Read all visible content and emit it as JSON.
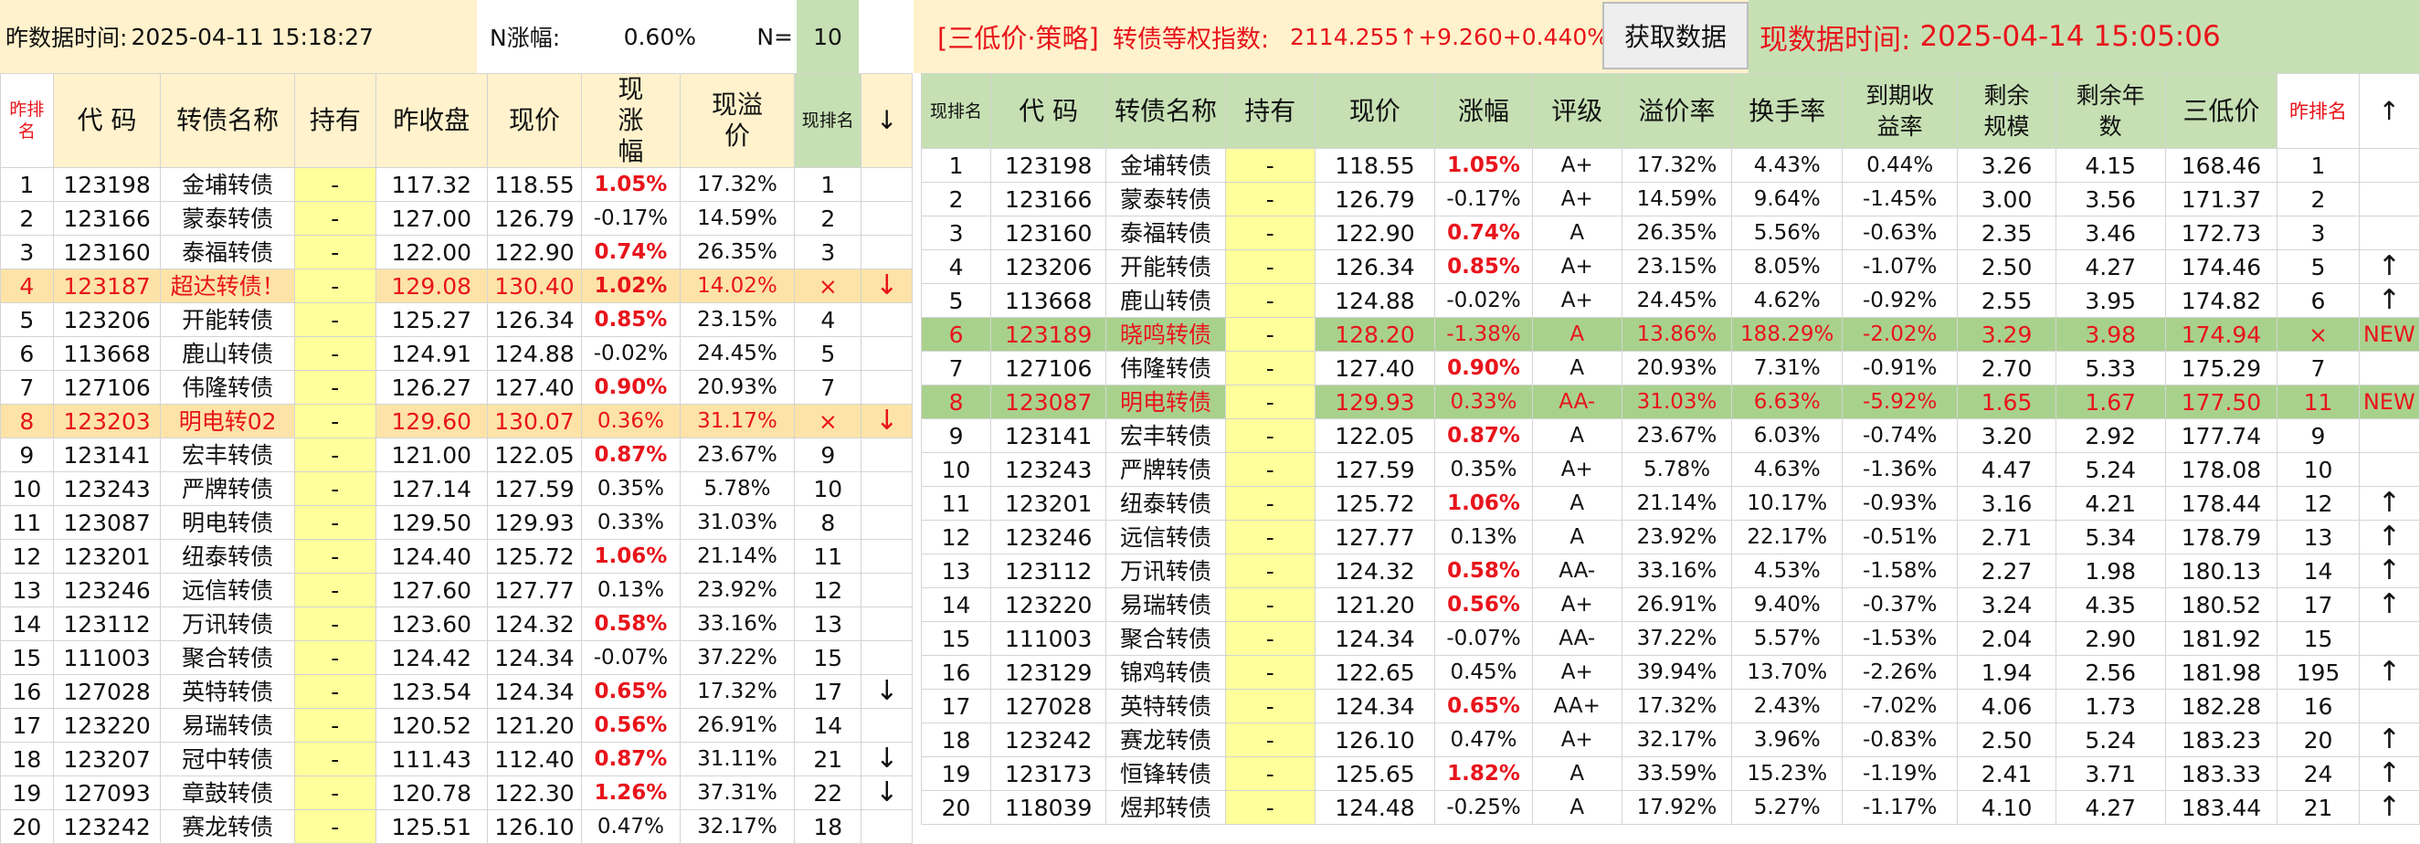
{
  "header": {
    "prev_time_label": "昨数据时间:",
    "prev_time": "2025-04-11 15:18:27",
    "n_change_label": "N涨幅:",
    "n_change_value": "0.60%",
    "n_label": "N=",
    "n_value": "10",
    "strategy": "[三低价·策略]",
    "index_label": "转债等权指数:",
    "index_value": "2114.255↑+9.260+0.440%",
    "fetch_button": "获取数据",
    "now_time_label": "现数据时间:",
    "now_time": "2025-04-14 15:05:06",
    "colors": {
      "title_yellow": "#fff2cc",
      "n_green": "#c6e0b4",
      "strategy_yellow": "#fff2cc",
      "now_green": "#c6e0b4",
      "red": "#e8141b"
    }
  },
  "left_table": {
    "headers": [
      "昨排名",
      "代 码",
      "转债名称",
      "持有",
      "昨收盘",
      "现价",
      "现涨幅",
      "现溢价",
      "现排名",
      "↓"
    ],
    "rows": [
      [
        "1",
        "123198",
        "金埔转债",
        "-",
        "117.32",
        "118.55",
        "1.05%",
        "17.32%",
        "1",
        ""
      ],
      [
        "2",
        "123166",
        "蒙泰转债",
        "-",
        "127.00",
        "126.79",
        "-0.17%",
        "14.59%",
        "2",
        ""
      ],
      [
        "3",
        "123160",
        "泰福转债",
        "-",
        "122.00",
        "122.90",
        "0.74%",
        "26.35%",
        "3",
        ""
      ],
      [
        "4",
        "123187",
        "超达转债！",
        "-",
        "129.08",
        "130.40",
        "1.02%",
        "14.02%",
        "×",
        "↓"
      ],
      [
        "5",
        "123206",
        "开能转债",
        "-",
        "125.27",
        "126.34",
        "0.85%",
        "23.15%",
        "4",
        ""
      ],
      [
        "6",
        "113668",
        "鹿山转债",
        "-",
        "124.91",
        "124.88",
        "-0.02%",
        "24.45%",
        "5",
        ""
      ],
      [
        "7",
        "127106",
        "伟隆转债",
        "-",
        "126.27",
        "127.40",
        "0.90%",
        "20.93%",
        "7",
        ""
      ],
      [
        "8",
        "123203",
        "明电转02",
        "-",
        "129.60",
        "130.07",
        "0.36%",
        "31.17%",
        "×",
        "↓"
      ],
      [
        "9",
        "123141",
        "宏丰转债",
        "-",
        "121.00",
        "122.05",
        "0.87%",
        "23.67%",
        "9",
        ""
      ],
      [
        "10",
        "123243",
        "严牌转债",
        "-",
        "127.14",
        "127.59",
        "0.35%",
        "5.78%",
        "10",
        ""
      ],
      [
        "11",
        "123087",
        "明电转债",
        "-",
        "129.50",
        "129.93",
        "0.33%",
        "31.03%",
        "8",
        ""
      ],
      [
        "12",
        "123201",
        "纽泰转债",
        "-",
        "124.40",
        "125.72",
        "1.06%",
        "21.14%",
        "11",
        ""
      ],
      [
        "13",
        "123246",
        "远信转债",
        "-",
        "127.60",
        "127.77",
        "0.13%",
        "23.92%",
        "12",
        ""
      ],
      [
        "14",
        "123112",
        "万讯转债",
        "-",
        "123.60",
        "124.32",
        "0.58%",
        "33.16%",
        "13",
        ""
      ],
      [
        "15",
        "111003",
        "聚合转债",
        "-",
        "124.42",
        "124.34",
        "-0.07%",
        "37.22%",
        "15",
        ""
      ],
      [
        "16",
        "127028",
        "英特转债",
        "-",
        "123.54",
        "124.34",
        "0.65%",
        "17.32%",
        "17",
        "↓"
      ],
      [
        "17",
        "123220",
        "易瑞转债",
        "-",
        "120.52",
        "121.20",
        "0.56%",
        "26.91%",
        "14",
        ""
      ],
      [
        "18",
        "123207",
        "冠中转债",
        "-",
        "111.43",
        "112.40",
        "0.87%",
        "31.11%",
        "21",
        "↓"
      ],
      [
        "19",
        "127093",
        "章鼓转债",
        "-",
        "120.78",
        "122.30",
        "1.26%",
        "37.31%",
        "22",
        "↓"
      ],
      [
        "20",
        "123242",
        "赛龙转债",
        "-",
        "125.51",
        "126.10",
        "0.47%",
        "32.17%",
        "18",
        ""
      ]
    ]
  },
  "right_table": {
    "headers": [
      "现排名",
      "代 码",
      "转债名称",
      "持有",
      "现价",
      "涨幅",
      "评级",
      "溢价率",
      "换手率",
      "到期收益率",
      "剩余规模",
      "剩余年数",
      "三低价",
      "昨排名",
      "↑"
    ],
    "rows": [
      [
        "1",
        "123198",
        "金埔转债",
        "-",
        "118.55",
        "1.05%",
        "A+",
        "17.32%",
        "4.43%",
        "0.44%",
        "3.26",
        "4.15",
        "168.46",
        "1",
        ""
      ],
      [
        "2",
        "123166",
        "蒙泰转债",
        "-",
        "126.79",
        "-0.17%",
        "A+",
        "14.59%",
        "9.64%",
        "-1.45%",
        "3.00",
        "3.56",
        "171.37",
        "2",
        ""
      ],
      [
        "3",
        "123160",
        "泰福转债",
        "-",
        "122.90",
        "0.74%",
        "A",
        "26.35%",
        "5.56%",
        "-0.63%",
        "2.35",
        "3.46",
        "172.73",
        "3",
        ""
      ],
      [
        "4",
        "123206",
        "开能转债",
        "-",
        "126.34",
        "0.85%",
        "A+",
        "23.15%",
        "8.05%",
        "-1.07%",
        "2.50",
        "4.27",
        "174.46",
        "5",
        "↑"
      ],
      [
        "5",
        "113668",
        "鹿山转债",
        "-",
        "124.88",
        "-0.02%",
        "A+",
        "24.45%",
        "4.62%",
        "-0.92%",
        "2.55",
        "3.95",
        "174.82",
        "6",
        "↑"
      ],
      [
        "6",
        "123189",
        "晓鸣转债",
        "-",
        "128.20",
        "-1.38%",
        "A",
        "13.86%",
        "188.29%",
        "-2.02%",
        "3.29",
        "3.98",
        "174.94",
        "×",
        "NEW"
      ],
      [
        "7",
        "127106",
        "伟隆转债",
        "-",
        "127.40",
        "0.90%",
        "A",
        "20.93%",
        "7.31%",
        "-0.91%",
        "2.70",
        "5.33",
        "175.29",
        "7",
        ""
      ],
      [
        "8",
        "123087",
        "明电转债",
        "-",
        "129.93",
        "0.33%",
        "AA-",
        "31.03%",
        "6.63%",
        "-5.92%",
        "1.65",
        "1.67",
        "177.50",
        "11",
        "NEW"
      ],
      [
        "9",
        "123141",
        "宏丰转债",
        "-",
        "122.05",
        "0.87%",
        "A",
        "23.67%",
        "6.03%",
        "-0.74%",
        "3.20",
        "2.92",
        "177.74",
        "9",
        ""
      ],
      [
        "10",
        "123243",
        "严牌转债",
        "-",
        "127.59",
        "0.35%",
        "A+",
        "5.78%",
        "4.63%",
        "-1.36%",
        "4.47",
        "5.24",
        "178.08",
        "10",
        ""
      ],
      [
        "11",
        "123201",
        "纽泰转债",
        "-",
        "125.72",
        "1.06%",
        "A",
        "21.14%",
        "10.17%",
        "-0.93%",
        "3.16",
        "4.21",
        "178.44",
        "12",
        "↑"
      ],
      [
        "12",
        "123246",
        "远信转债",
        "-",
        "127.77",
        "0.13%",
        "A",
        "23.92%",
        "22.17%",
        "-0.51%",
        "2.71",
        "5.34",
        "178.79",
        "13",
        "↑"
      ],
      [
        "13",
        "123112",
        "万讯转债",
        "-",
        "124.32",
        "0.58%",
        "AA-",
        "33.16%",
        "4.53%",
        "-1.58%",
        "2.27",
        "1.98",
        "180.13",
        "14",
        "↑"
      ],
      [
        "14",
        "123220",
        "易瑞转债",
        "-",
        "121.20",
        "0.56%",
        "A+",
        "26.91%",
        "9.40%",
        "-0.37%",
        "3.24",
        "4.35",
        "180.52",
        "17",
        "↑"
      ],
      [
        "15",
        "111003",
        "聚合转债",
        "-",
        "124.34",
        "-0.07%",
        "AA-",
        "37.22%",
        "5.57%",
        "-1.53%",
        "2.04",
        "2.90",
        "181.92",
        "15",
        ""
      ],
      [
        "16",
        "123129",
        "锦鸡转债",
        "-",
        "122.65",
        "0.45%",
        "A+",
        "39.94%",
        "13.70%",
        "-2.26%",
        "1.94",
        "2.56",
        "181.98",
        "195",
        "↑"
      ],
      [
        "17",
        "127028",
        "英特转债",
        "-",
        "124.34",
        "0.65%",
        "AA+",
        "17.32%",
        "2.43%",
        "-7.02%",
        "4.06",
        "1.73",
        "182.28",
        "16",
        ""
      ],
      [
        "18",
        "123242",
        "赛龙转债",
        "-",
        "126.10",
        "0.47%",
        "A+",
        "32.17%",
        "3.96%",
        "-0.83%",
        "2.50",
        "5.24",
        "183.23",
        "20",
        "↑"
      ],
      [
        "19",
        "123173",
        "恒锋转债",
        "-",
        "125.65",
        "1.82%",
        "A",
        "33.59%",
        "15.23%",
        "-1.19%",
        "2.41",
        "3.71",
        "183.33",
        "24",
        "↑"
      ],
      [
        "20",
        "118039",
        "煜邦转债",
        "-",
        "124.48",
        "-0.25%",
        "A",
        "17.92%",
        "5.27%",
        "-1.17%",
        "4.10",
        "4.27",
        "183.44",
        "21",
        "↑"
      ]
    ]
  }
}
